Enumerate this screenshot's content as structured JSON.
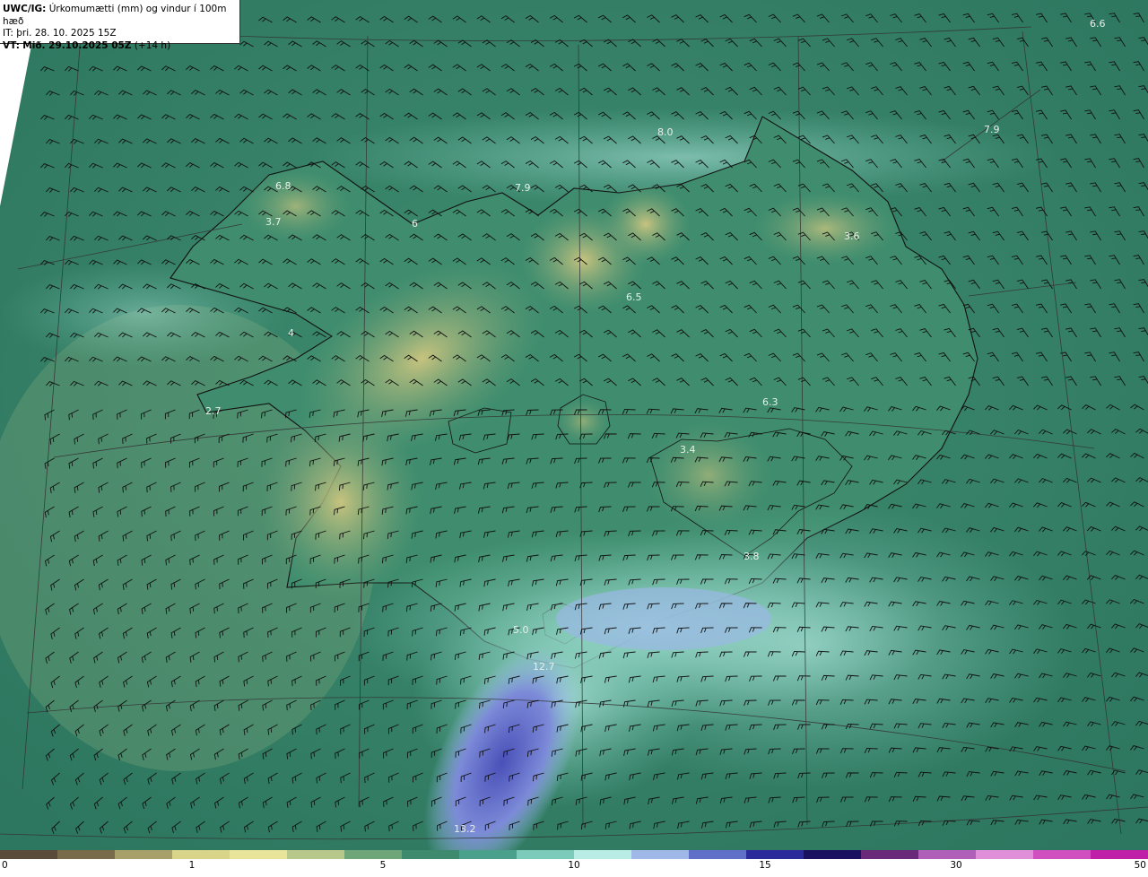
{
  "header": {
    "product": "UWC/IG:",
    "title": "Úrkomumætti (mm) og vindur í 100m hæð",
    "it_label": "IT:",
    "it_value": "þri. 28. 10. 2025 15Z",
    "vt_label": "VT:",
    "vt_value": "Mið. 29.10.2025 05Z",
    "vt_offset": "(+14 h)"
  },
  "map_labels": [
    {
      "id": "lbl-1",
      "text": "6.6"
    },
    {
      "id": "lbl-2",
      "text": "8.0"
    },
    {
      "id": "lbl-3",
      "text": "7.9"
    },
    {
      "id": "lbl-4",
      "text": "6.8"
    },
    {
      "id": "lbl-5",
      "text": "7.9"
    },
    {
      "id": "lbl-6",
      "text": "3.7"
    },
    {
      "id": "lbl-7",
      "text": "6"
    },
    {
      "id": "lbl-8",
      "text": "3.6"
    },
    {
      "id": "lbl-9",
      "text": "6.5"
    },
    {
      "id": "lbl-10",
      "text": "4"
    },
    {
      "id": "lbl-11",
      "text": "2.7"
    },
    {
      "id": "lbl-12",
      "text": "6.3"
    },
    {
      "id": "lbl-13",
      "text": "3.4"
    },
    {
      "id": "lbl-14",
      "text": "3.8"
    },
    {
      "id": "lbl-15",
      "text": "5.0"
    },
    {
      "id": "lbl-16",
      "text": "12.7"
    },
    {
      "id": "lbl-17",
      "text": "13.2"
    }
  ],
  "colorbar": {
    "ticks": [
      "0",
      "1",
      "5",
      "10",
      "15",
      "30",
      "50"
    ],
    "colors": [
      "#5a4a3a",
      "#7a6a4c",
      "#a8a06a",
      "#d8d48a",
      "#e8e49a",
      "#b8c88a",
      "#6ea67a",
      "#3e8a6e",
      "#4aa08a",
      "#7ccaba",
      "#b8ece4",
      "#a0b8e8",
      "#6070c8",
      "#2a2a9a",
      "#1a1060",
      "#6a2a7a",
      "#b060b8",
      "#e090d8",
      "#d050c0",
      "#c020a8"
    ]
  },
  "colors": {
    "sea": "#2f7a62",
    "land_low": "#3d8a6c",
    "land_dry": "#b8b874",
    "wet": "#a8e4dc",
    "heavy": "#5860c0"
  }
}
